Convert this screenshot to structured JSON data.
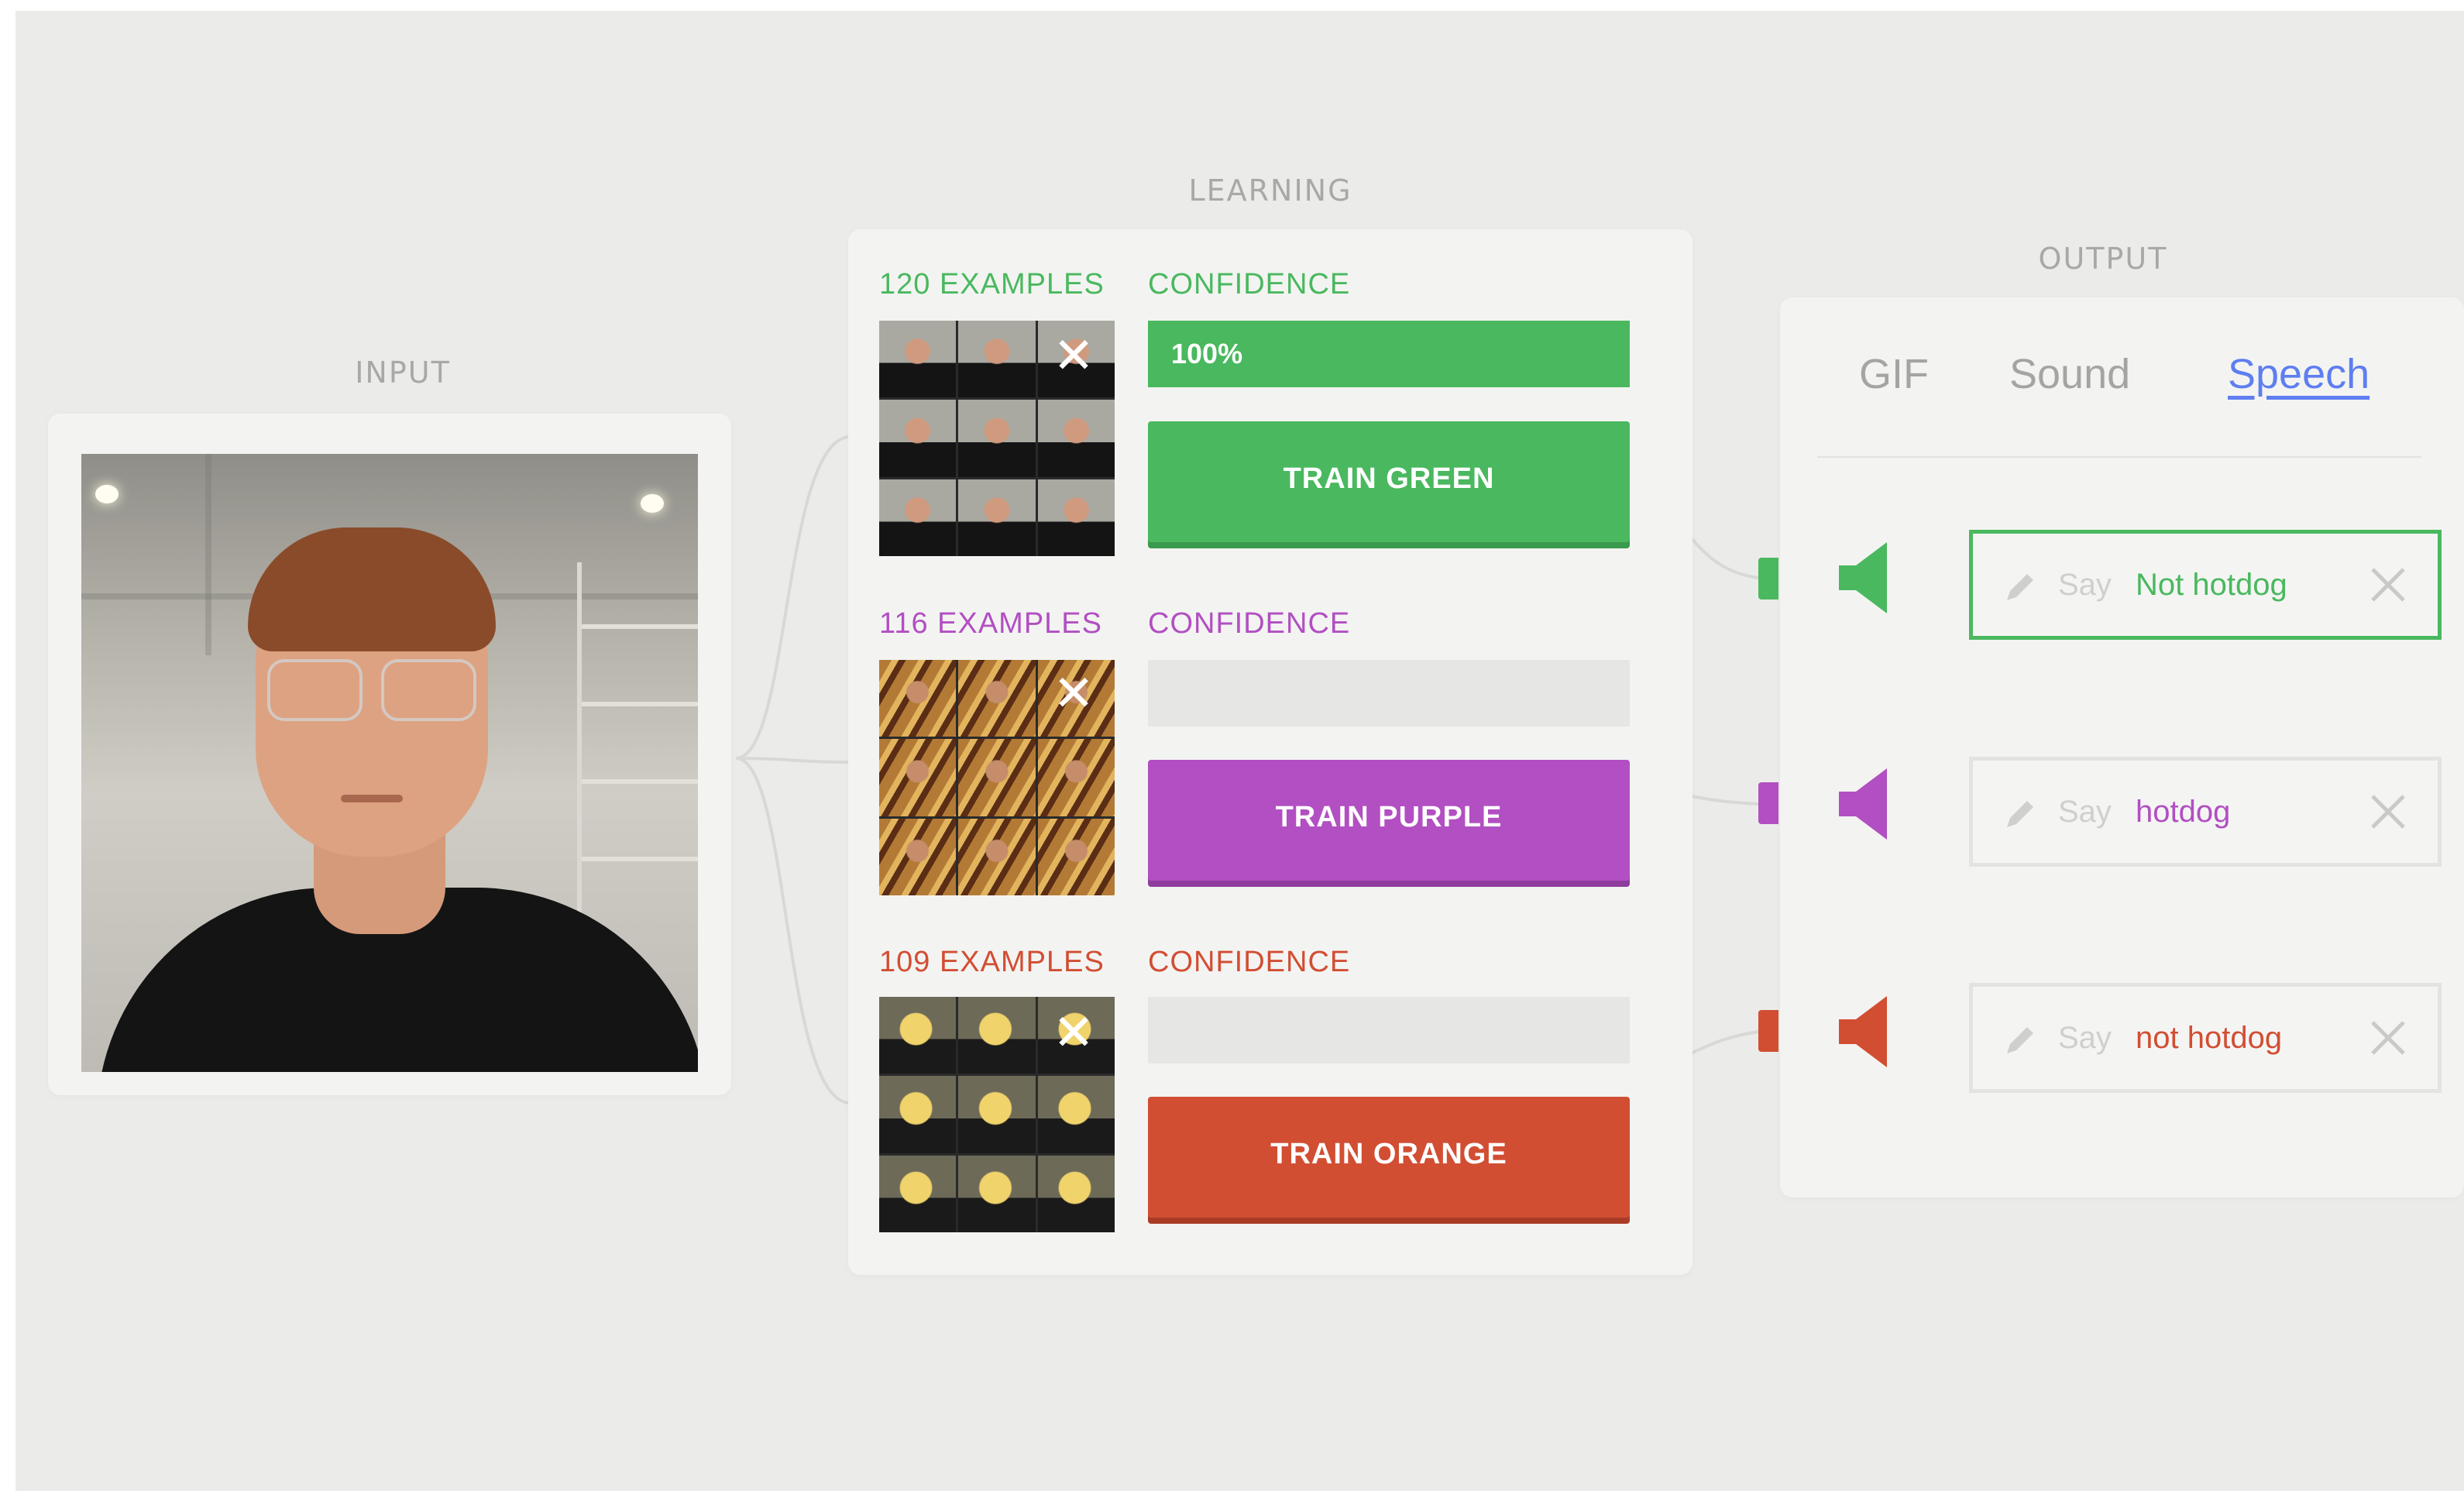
{
  "sections": {
    "input": "INPUT",
    "learning": "LEARNING",
    "output": "OUTPUT"
  },
  "classes": [
    {
      "examples": "120 EXAMPLES",
      "confidence_label": "CONFIDENCE",
      "confidence_value": "100%",
      "confidence": 1.0,
      "button": "TRAIN GREEN",
      "color": "#4ab85f",
      "dark": "#3a9a4d"
    },
    {
      "examples": "116 EXAMPLES",
      "confidence_label": "CONFIDENCE",
      "confidence_value": "",
      "confidence": 0.0,
      "button": "TRAIN PURPLE",
      "color": "#b24fc2",
      "dark": "#8f3c9e"
    },
    {
      "examples": "109 EXAMPLES",
      "confidence_label": "CONFIDENCE",
      "confidence_value": "",
      "confidence": 0.0,
      "button": "TRAIN ORANGE",
      "color": "#d24e33",
      "dark": "#aa3c26"
    }
  ],
  "output": {
    "tabs": [
      "GIF",
      "Sound",
      "Speech"
    ],
    "active_tab": "Speech",
    "say_prefix": "Say",
    "rows": [
      {
        "text": "Not hotdog",
        "color": "#4ab85f",
        "active": true
      },
      {
        "text": "hotdog",
        "color": "#b24fc2",
        "active": false
      },
      {
        "text": "not hotdog",
        "color": "#d24e33",
        "active": false
      }
    ]
  },
  "icons": {
    "remove_examples": "close-icon",
    "speaker": "speaker-icon",
    "edit": "pencil-icon",
    "clear": "close-icon"
  }
}
